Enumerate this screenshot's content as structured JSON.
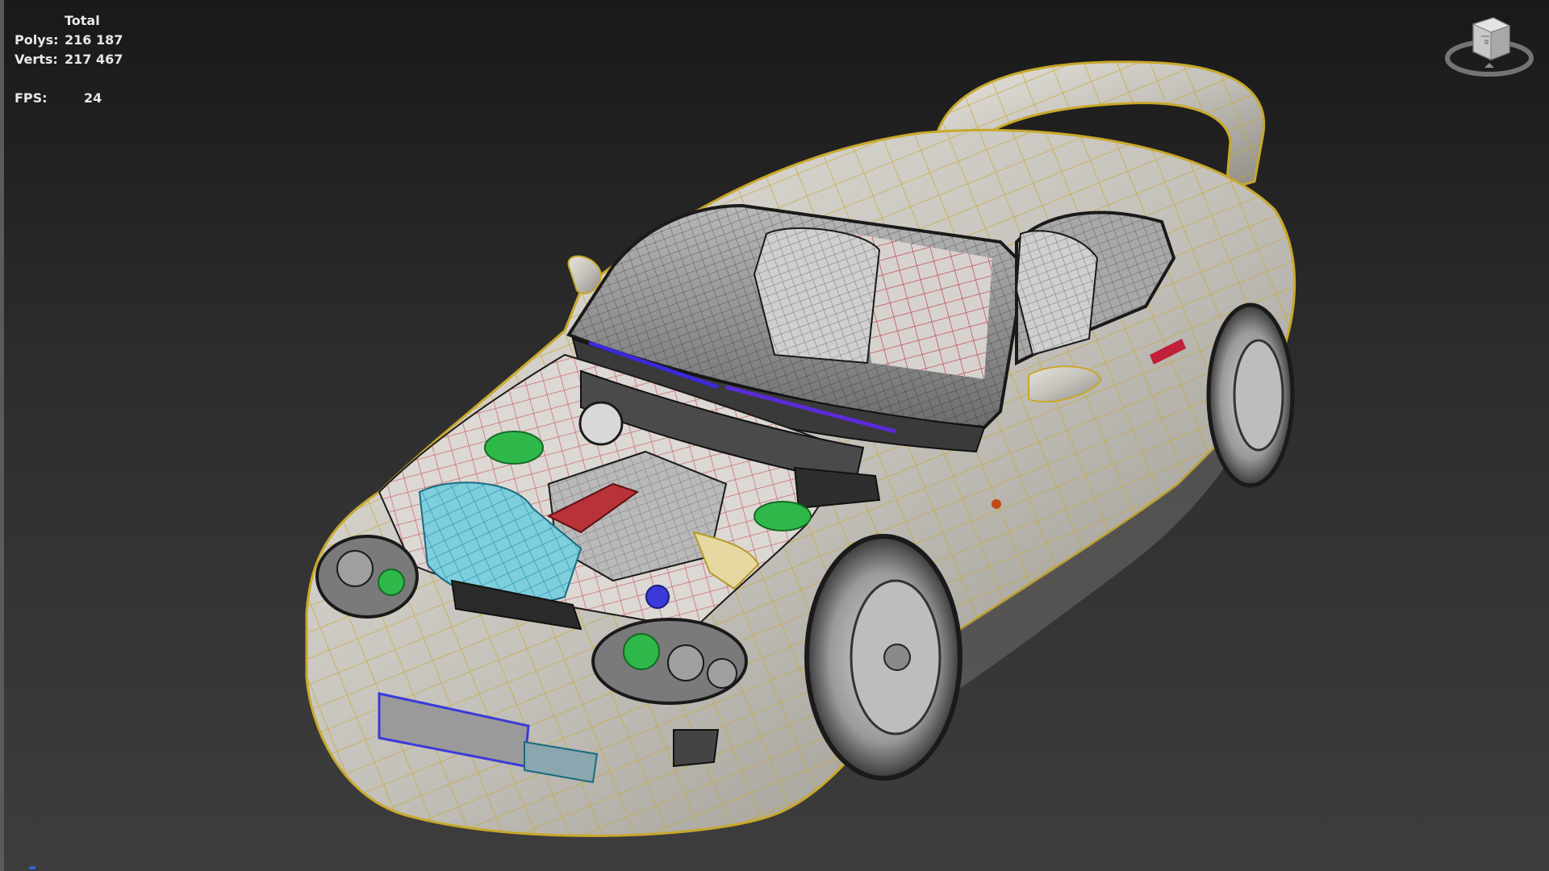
{
  "stats": {
    "header": "Total",
    "polys_label": "Polys:",
    "polys_value": "216 187",
    "verts_label": "Verts:",
    "verts_value": "217 467",
    "fps_label": "FPS:",
    "fps_value": "24"
  },
  "icons": {
    "viewcube": "viewcube-icon",
    "model": "car-wireframe-model"
  },
  "colors": {
    "background_top": "#191919",
    "background_bottom": "#3d3d3d",
    "body_shell": "#c9c6c0",
    "body_wire": "#c8a82a",
    "interior_wire": "#c0203a",
    "intake_wire": "#2fc6d8",
    "highlight_green": "#2fb84a",
    "selection_blue": "#3a2ad8"
  }
}
